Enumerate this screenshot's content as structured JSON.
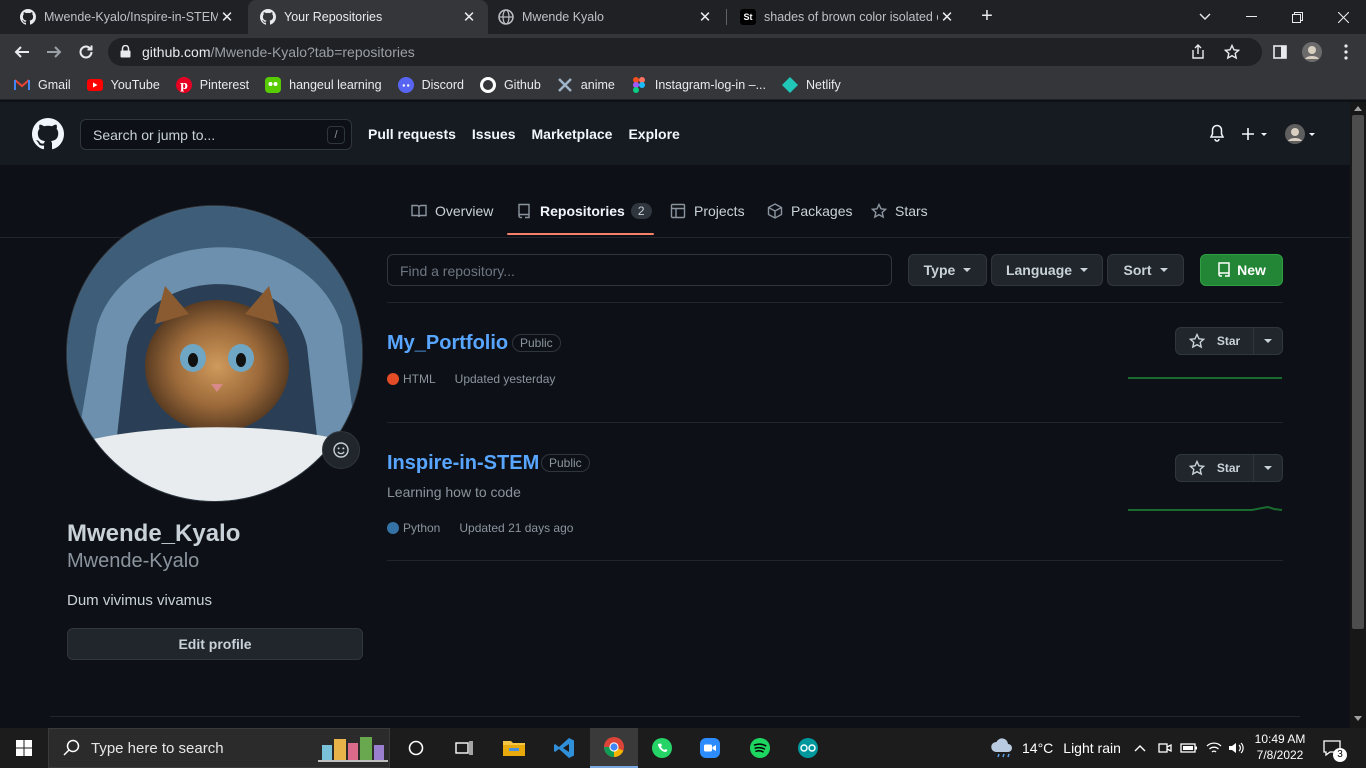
{
  "browser": {
    "tabs": [
      {
        "title": "Mwende-Kyalo/Inspire-in-STEM:",
        "icon": "github-icon",
        "active": false
      },
      {
        "title": "Your Repositories",
        "icon": "github-icon",
        "active": true
      },
      {
        "title": "Mwende Kyalo",
        "icon": "globe-icon",
        "active": false
      },
      {
        "title": "shades of brown color isolated o",
        "icon": "st-icon",
        "active": false
      }
    ],
    "url_host": "github.com",
    "url_path": "/Mwende-Kyalo?tab=repositories",
    "bookmarks": [
      "Gmail",
      "YouTube",
      "Pinterest",
      "hangeul learning",
      "Discord",
      "Github",
      "anime",
      "Instagram-log-in –...",
      "Netlify"
    ]
  },
  "gh_header": {
    "search_placeholder": "Search or jump to...",
    "search_shortcut": "/",
    "nav": [
      "Pull requests",
      "Issues",
      "Marketplace",
      "Explore"
    ]
  },
  "profile_tabs": {
    "overview": "Overview",
    "repositories": "Repositories",
    "repositories_count": "2",
    "projects": "Projects",
    "packages": "Packages",
    "stars": "Stars"
  },
  "profile": {
    "name": "Mwende_Kyalo",
    "login": "Mwende-Kyalo",
    "bio": "Dum vivimus vivamus",
    "edit_label": "Edit profile"
  },
  "filters": {
    "find_placeholder": "Find a repository...",
    "type": "Type",
    "language": "Language",
    "sort": "Sort",
    "new": "New"
  },
  "repos": [
    {
      "name": "My_Portfolio",
      "visibility": "Public",
      "description": "",
      "language": "HTML",
      "lang_color": "#e34c26",
      "updated": "Updated yesterday",
      "star_label": "Star"
    },
    {
      "name": "Inspire-in-STEM",
      "visibility": "Public",
      "description": "Learning how to code",
      "language": "Python",
      "lang_color": "#3572A5",
      "updated": "Updated 21 days ago",
      "star_label": "Star"
    }
  ],
  "taskbar": {
    "search_placeholder": "Type here to search",
    "weather_temp": "14°C",
    "weather_text": "Light rain",
    "time": "10:49 AM",
    "date": "7/8/2022",
    "notifications": "3"
  }
}
